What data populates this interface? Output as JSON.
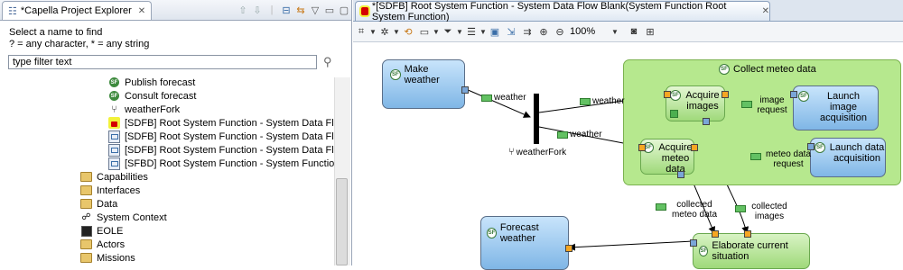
{
  "explorer": {
    "tab_title": "*Capella Project Explorer",
    "find_label_1": "Select a name to find",
    "find_label_2": "? = any character, * = any string",
    "filter_value": "type filter text",
    "tree": [
      {
        "label": "Publish forecast",
        "icon": "system-function-icon"
      },
      {
        "label": "Consult forecast",
        "icon": "system-function-icon"
      },
      {
        "label": "weatherFork",
        "icon": "fork-icon"
      },
      {
        "label": "[SDFB] Root System Function - System Data Flow Blar",
        "icon": "locked-diagram-icon"
      },
      {
        "label": "[SDFB] Root System Function - System Data Flow Blar",
        "icon": "diagram-icon"
      },
      {
        "label": "[SDFB] Root System Function - System Data Flow Blar",
        "icon": "diagram-icon"
      },
      {
        "label": "[SFBD] Root System Function - System Function Breal",
        "icon": "diagram-icon"
      },
      {
        "label": "Capabilities",
        "icon": "folder-icon"
      },
      {
        "label": "Interfaces",
        "icon": "folder-icon"
      },
      {
        "label": "Data",
        "icon": "folder-icon"
      },
      {
        "label": "System Context",
        "icon": "context-icon"
      },
      {
        "label": "EOLE",
        "icon": "system-icon"
      },
      {
        "label": "Actors",
        "icon": "folder-icon"
      },
      {
        "label": "Missions",
        "icon": "folder-icon"
      }
    ]
  },
  "editor": {
    "tab_title": "*[SDFB] Root System Function - System Data Flow Blank(System Function Root System Function)",
    "zoom": "100%"
  },
  "diagram": {
    "functions": {
      "make_weather": "Make weather",
      "collect_meteo": "Collect meteo data",
      "acquire_images": "Acquire images",
      "launch_image": "Launch image acquisition",
      "acquire_meteo": "Acquire meteo data",
      "launch_data": "Launch data acquisition",
      "forecast_weather": "Forecast weather",
      "elaborate": "Elaborate current situation"
    },
    "fork_label": "weatherFork",
    "exchanges": {
      "weather_1": "weather",
      "weather_2": "weather",
      "weather_3": "weather",
      "image_request": "image request",
      "meteo_data_request": "meteo data request",
      "collected_meteo": "collected meteo data",
      "collected_images": "collected images"
    }
  }
}
